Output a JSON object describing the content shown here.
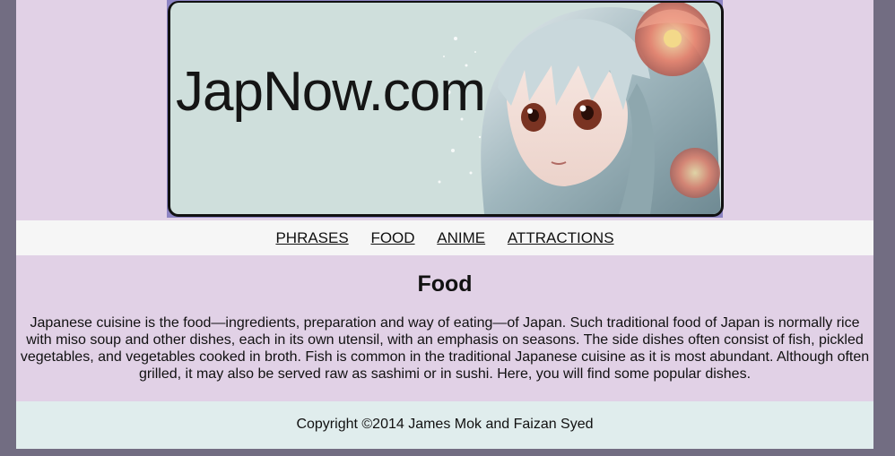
{
  "banner": {
    "title": "JapNow.com"
  },
  "nav": {
    "items": [
      "PHRASES",
      "FOOD",
      "ANIME",
      "ATTRACTIONS"
    ]
  },
  "main": {
    "heading": "Food",
    "paragraph": "Japanese cuisine is the food—ingredients, preparation and way of eating—of Japan. Such traditional food of Japan is normally rice with miso soup and other dishes, each in its own utensil, with an emphasis on seasons. The side dishes often consist of fish, pickled vegetables, and vegetables cooked in broth. Fish is common in the traditional Japanese cuisine as it is most abundant. Although often grilled, it may also be served raw as sashimi or in sushi. Here, you will find some popular dishes."
  },
  "footer": {
    "copyright": "Copyright ©2014 James Mok and Faizan Syed"
  },
  "colors": {
    "outer_background": "#726d82",
    "page_background": "#e1d1e6",
    "nav_background": "#f6f6f6",
    "footer_background": "#e0eded",
    "banner_background": "#cfdfdc"
  }
}
